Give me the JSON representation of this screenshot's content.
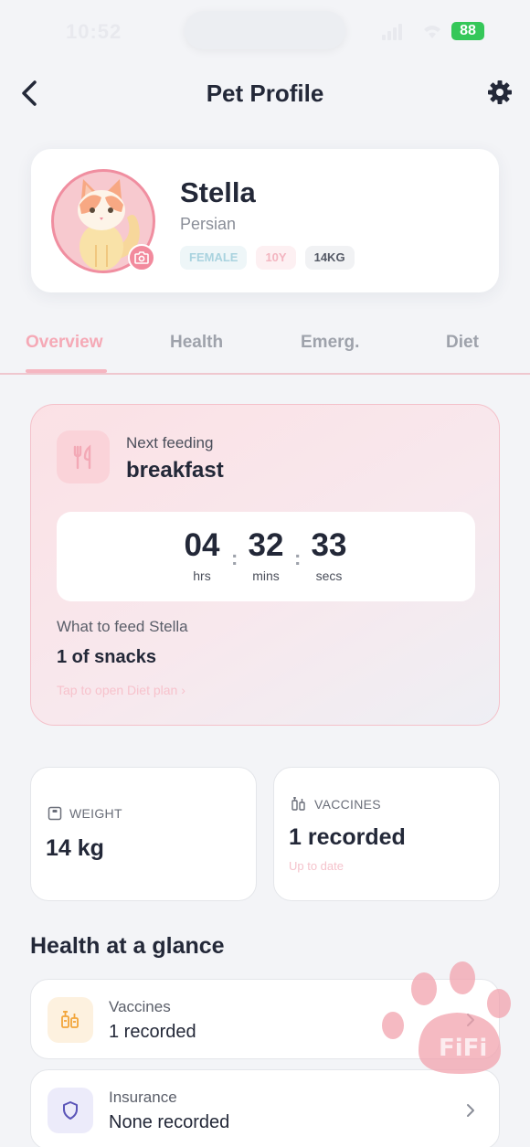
{
  "status_bar": {
    "time": "10:52",
    "battery": "88"
  },
  "header": {
    "title": "Pet Profile"
  },
  "pet": {
    "name": "Stella",
    "breed": "Persian",
    "badges": {
      "gender": "FEMALE",
      "age": "10Y",
      "weight": "14KG"
    }
  },
  "tabs": [
    {
      "label": "Overview",
      "active": true
    },
    {
      "label": "Health"
    },
    {
      "label": "Emerg."
    },
    {
      "label": "Diet"
    }
  ],
  "feeding": {
    "label": "Next feeding",
    "value": "breakfast",
    "countdown": {
      "hours": "04",
      "hours_label": "hrs",
      "mins": "32",
      "mins_label": "mins",
      "secs": "33",
      "secs_label": "secs",
      "separator": ":"
    },
    "what_label": "What to feed Stella",
    "what_value": "1 of snacks",
    "link": "Tap to open Diet plan  ›"
  },
  "stats": {
    "weight": {
      "label": "WEIGHT",
      "value": "14 kg"
    },
    "vaccines": {
      "label": "VACCINES",
      "value": "1 recorded",
      "sub": "Up to date"
    }
  },
  "health": {
    "title": "Health at a glance",
    "items": [
      {
        "title": "Vaccines",
        "value": "1 recorded"
      },
      {
        "title": "Insurance",
        "value": "None recorded"
      }
    ]
  },
  "watermark": "FiFi",
  "colors": {
    "accent": "#f5a9b6",
    "text": "#232838",
    "background": "#f3f4f7",
    "battery": "#35c759"
  }
}
